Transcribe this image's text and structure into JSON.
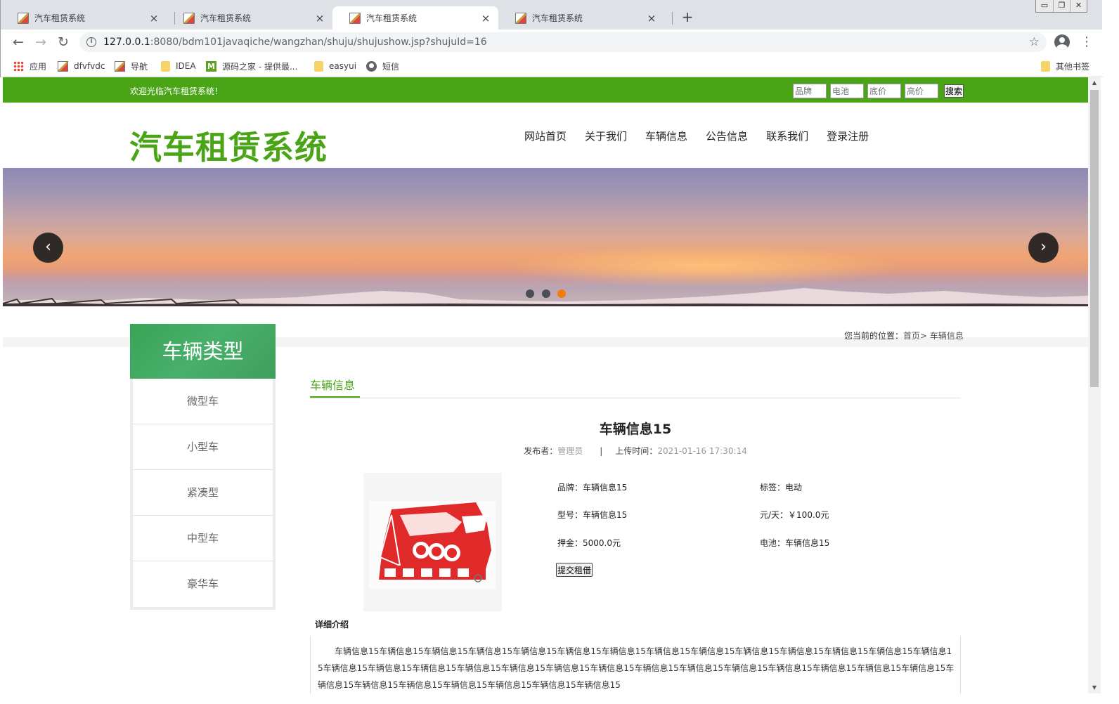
{
  "browser": {
    "tabs": [
      {
        "title": "汽车租赁系统",
        "active": false
      },
      {
        "title": "汽车租赁系统",
        "active": false
      },
      {
        "title": "汽车租赁系统",
        "active": true
      },
      {
        "title": "汽车租赁系统",
        "active": false
      }
    ],
    "new_tab": "+",
    "url_host": "127.0.0.1",
    "url_rest": ":8080/bdm101javaqiche/wangzhan/shuju/shujushow.jsp?shujuId=16",
    "bookmarks": [
      {
        "label": "应用",
        "icon": "apps-grid-icon"
      },
      {
        "label": "dfvfvdc",
        "icon": "image-icon"
      },
      {
        "label": "导航",
        "icon": "image-icon"
      },
      {
        "label": "IDEA",
        "icon": "folder-icon"
      },
      {
        "label": "源码之家 - 提供最...",
        "icon": "m-logo-icon"
      },
      {
        "label": "easyui",
        "icon": "folder-icon"
      },
      {
        "label": "短信",
        "icon": "globe-icon"
      }
    ],
    "other_bookmarks": "其他书签"
  },
  "site": {
    "welcome": "欢迎光临汽车租赁系统！",
    "search": {
      "brand_placeholder": "品牌",
      "battery_placeholder": "电池",
      "low_price_placeholder": "底价",
      "high_price_placeholder": "高价",
      "button": "搜索"
    },
    "title": "汽车租赁系统",
    "nav": [
      "网站首页",
      "关于我们",
      "车辆信息",
      "公告信息",
      "联系我们",
      "登录注册"
    ],
    "banner": {
      "prev": "‹",
      "next": "›",
      "slide_count": 3,
      "active_slide": 3
    },
    "breadcrumb": {
      "prefix": "您当前的位置：",
      "home": "首页",
      "sep": ">",
      "current": "车辆信息"
    }
  },
  "sidebar": {
    "title": "车辆类型",
    "items": [
      "微型车",
      "小型车",
      "紧凑型",
      "中型车",
      "豪华车"
    ]
  },
  "article": {
    "section_title": "车辆信息",
    "title": "车辆信息15",
    "publisher_label": "发布者：",
    "publisher": "管理员",
    "divider": "|",
    "time_label": "上传时间：",
    "time": "2021-01-16 17:30:14",
    "specs": {
      "brand": "品牌：车辆信息15",
      "tag": "标签：电动",
      "model": "型号：车辆信息15",
      "price": "元/天：￥100.0元",
      "deposit": "押金：5000.0元",
      "battery": "电池：车辆信息15"
    },
    "rent_button": "提交租借",
    "detail_label": "详细介绍",
    "detail_text": "车辆信息15车辆信息15车辆信息15车辆信息15车辆信息15车辆信息15车辆信息15车辆信息15车辆信息15车辆信息15车辆信息15车辆信息15车辆信息15车辆信息15车辆信息15车辆信息15车辆信息15车辆信息15车辆信息15车辆信息15车辆信息15车辆信息15车辆信息15车辆信息15车辆信息15车辆信息15车辆信息15车辆信息15车辆信息15车辆信息15车辆信息15车辆信息15车辆信息15车辆信息15车辆信息15"
  },
  "colors": {
    "brand_green": "#4aa516",
    "sidebar_green": "#3aa357",
    "active_dot": "#f27d0c"
  }
}
